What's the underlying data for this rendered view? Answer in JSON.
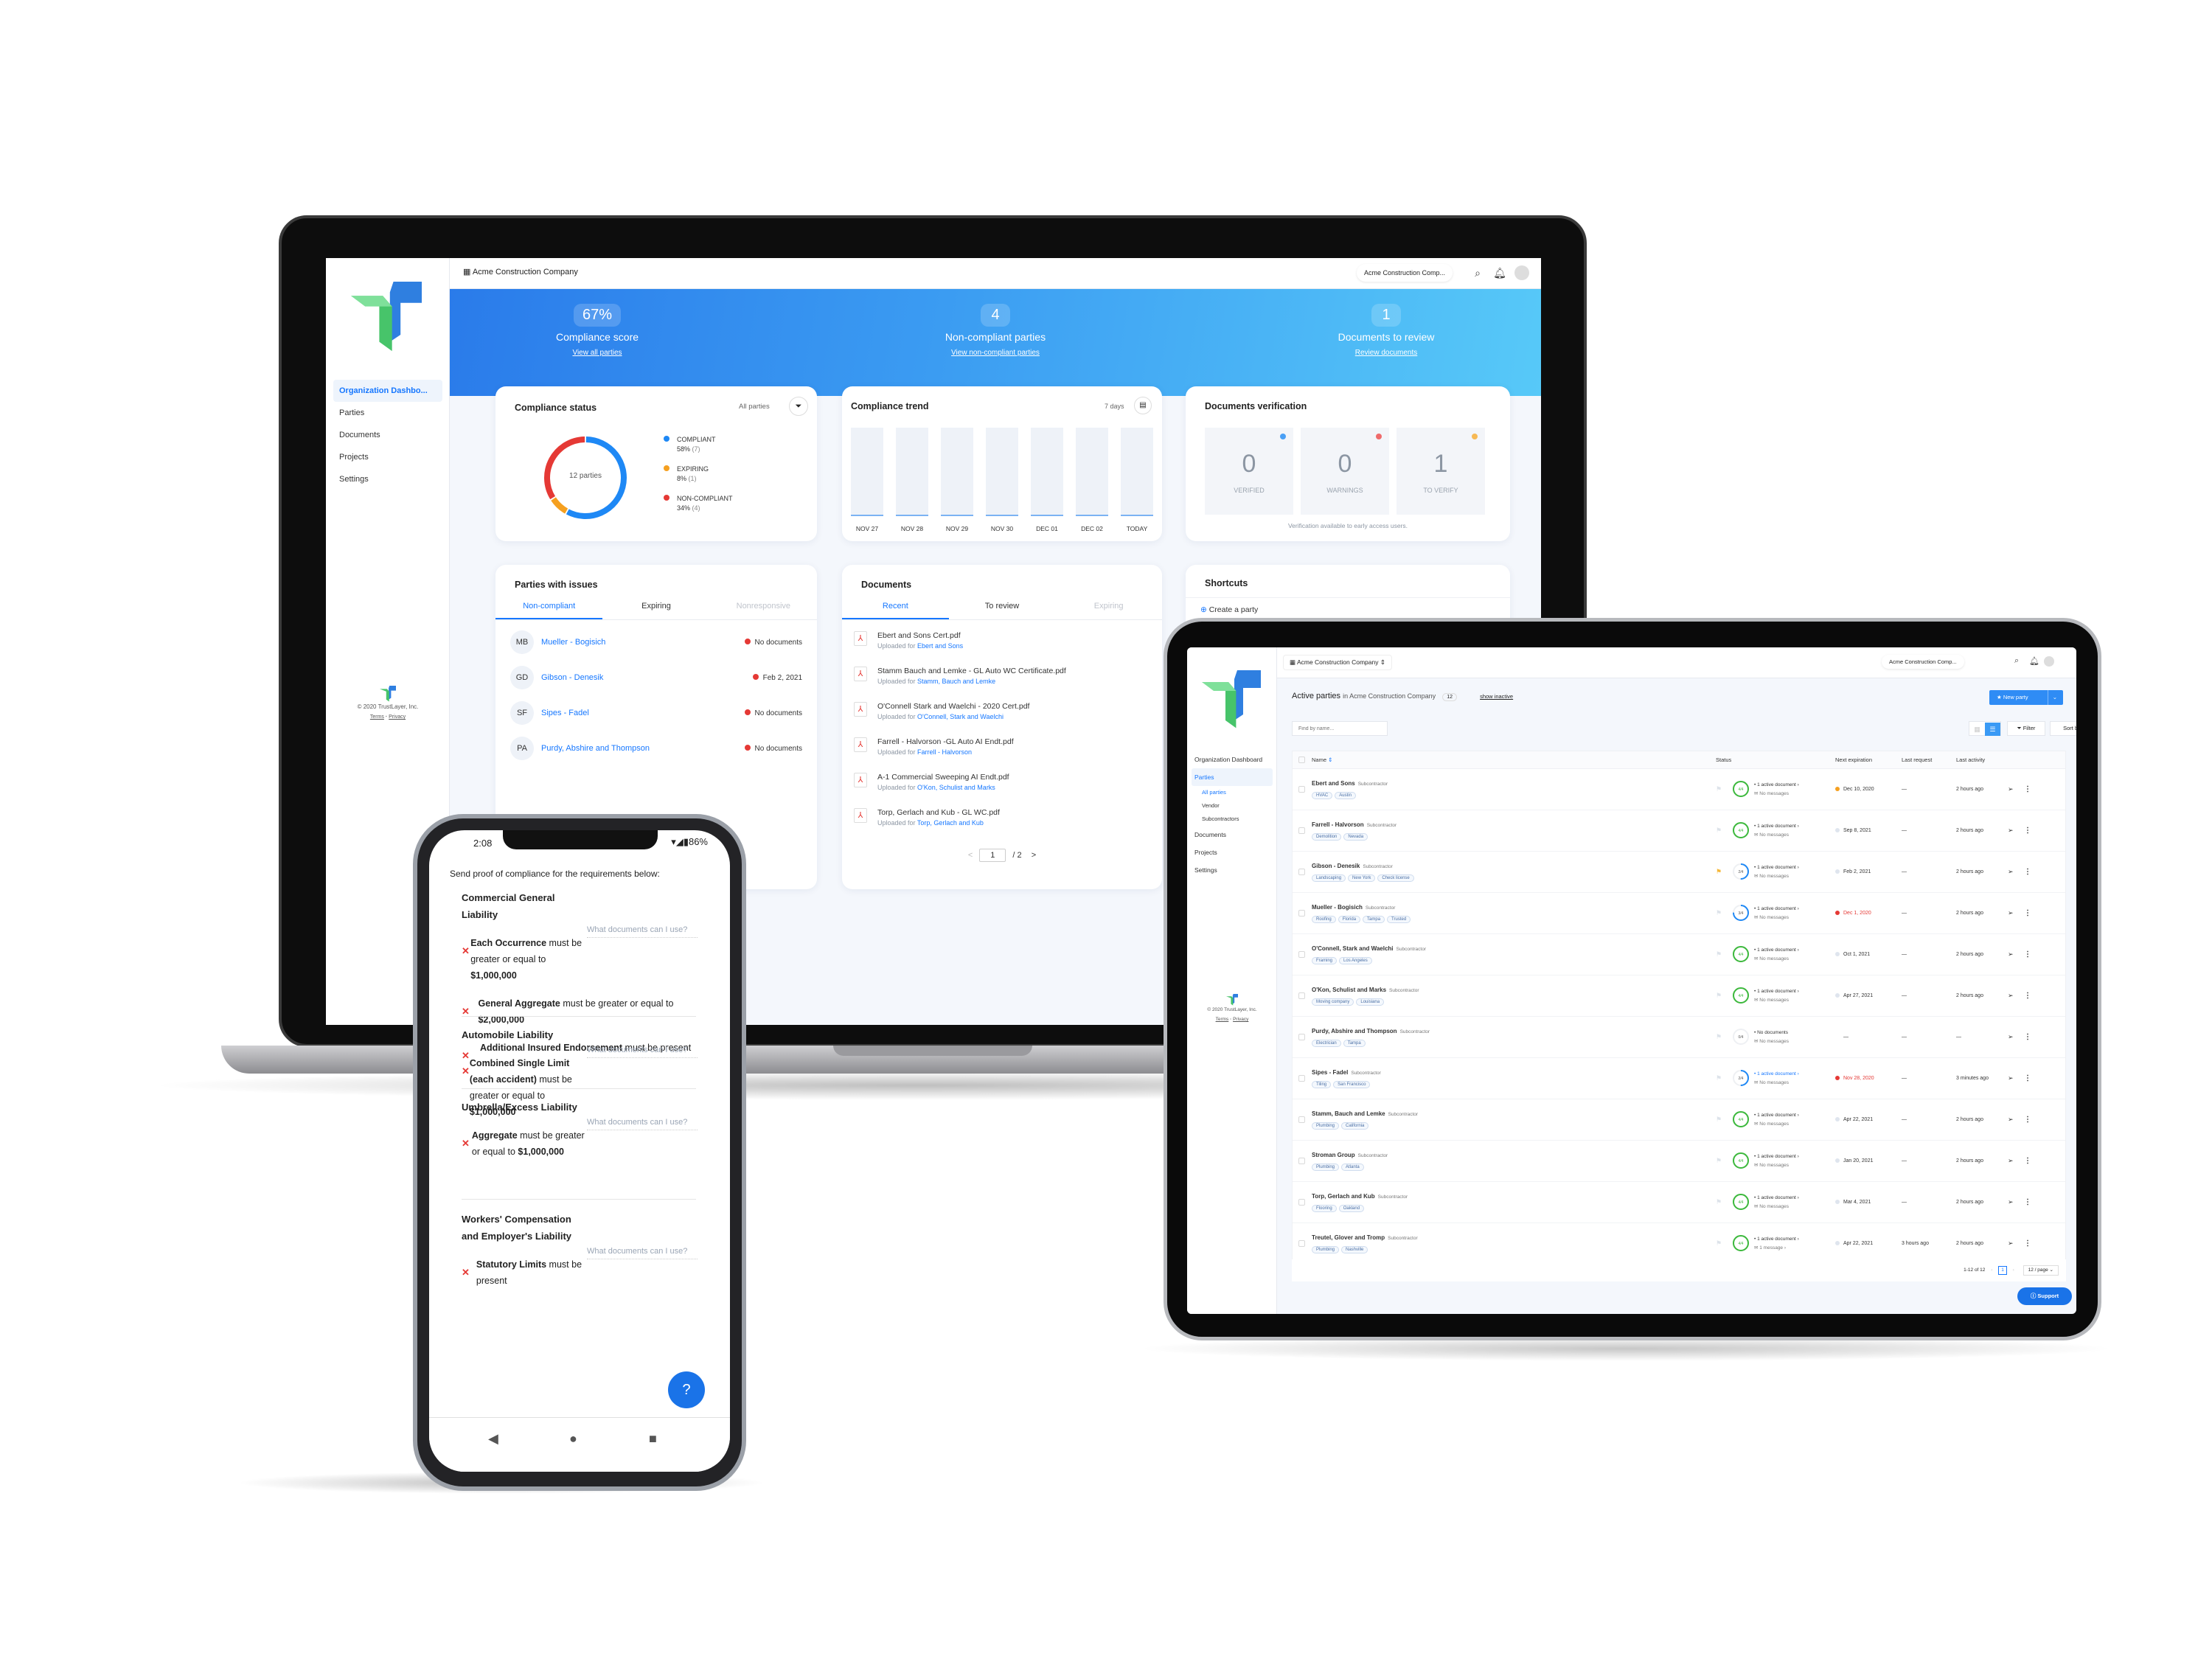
{
  "laptop": {
    "sidebar": {
      "items": [
        {
          "label": "Organization Dashbo...",
          "active": true
        },
        {
          "label": "Parties"
        },
        {
          "label": "Documents"
        },
        {
          "label": "Projects"
        },
        {
          "label": "Settings"
        }
      ],
      "footer": {
        "copyright": "© 2020 TrustLayer, Inc.",
        "terms": "Terms",
        "sep": " · ",
        "privacy": "Privacy"
      }
    },
    "topbar": {
      "org": "Acme Construction Company",
      "org_selector": "Acme Construction Comp...",
      "icons": [
        "building-icon",
        "search-icon",
        "bell-icon",
        "avatar"
      ]
    },
    "hero": [
      {
        "value": "67%",
        "label": "Compliance score",
        "link": "View all parties"
      },
      {
        "value": "4",
        "label": "Non-compliant parties",
        "link": "View non-compliant parties"
      },
      {
        "value": "1",
        "label": "Documents to review",
        "link": "Review documents"
      }
    ],
    "compliance_status": {
      "title": "Compliance status",
      "filter_label": "All parties",
      "center": "12 parties",
      "legend": [
        {
          "label": "COMPLIANT",
          "pct": "58%",
          "count": "(7)",
          "color": "#1e88f5"
        },
        {
          "label": "EXPIRING",
          "pct": "8%",
          "count": "(1)",
          "color": "#f5a020"
        },
        {
          "label": "NON-COMPLIANT",
          "pct": "34%",
          "count": "(4)",
          "color": "#e53935"
        }
      ]
    },
    "compliance_trend": {
      "title": "Compliance trend",
      "range": "7 days",
      "days": [
        "NOV 27",
        "NOV 28",
        "NOV 29",
        "NOV 30",
        "DEC 01",
        "DEC 02",
        "TODAY"
      ],
      "values": [
        0.02,
        0.02,
        0.02,
        0.02,
        0.02,
        0.02,
        0.02
      ]
    },
    "documents_verification": {
      "title": "Documents verification",
      "boxes": [
        {
          "value": "0",
          "label": "VERIFIED",
          "color": "#4a9ff5"
        },
        {
          "value": "0",
          "label": "WARNINGS",
          "color": "#ef6b6b"
        },
        {
          "value": "1",
          "label": "TO VERIFY",
          "color": "#f7b955"
        }
      ],
      "note": "Verification available to early access users."
    },
    "parties_with_issues": {
      "title": "Parties with issues",
      "tabs": [
        "Non-compliant",
        "Expiring",
        "Nonresponsive"
      ],
      "rows": [
        {
          "initials": "MB",
          "name": "Mueller - Bogisich",
          "status": "No documents"
        },
        {
          "initials": "GD",
          "name": "Gibson - Denesik",
          "status": "Feb 2, 2021"
        },
        {
          "initials": "SF",
          "name": "Sipes - Fadel",
          "status": "No documents"
        },
        {
          "initials": "PA",
          "name": "Purdy, Abshire and Thompson",
          "status": "No documents"
        }
      ]
    },
    "documents": {
      "title": "Documents",
      "tabs": [
        "Recent",
        "To review",
        "Expiring"
      ],
      "uploaded_prefix": "Uploaded for ",
      "rows": [
        {
          "file": "Ebert and Sons Cert.pdf",
          "party": "Ebert and Sons"
        },
        {
          "file": "Stamm Bauch and Lemke - GL Auto WC Certificate.pdf",
          "party": "Stamm, Bauch and Lemke"
        },
        {
          "file": "O'Connell Stark and Waelchi - 2020 Cert.pdf",
          "party": "O'Connell, Stark and Waelchi"
        },
        {
          "file": "Farrell - Halvorson -GL Auto AI Endt.pdf",
          "party": "Farrell - Halvorson"
        },
        {
          "file": "A-1 Commercial Sweeping AI Endt.pdf",
          "party": "O'Kon, Schulist and Marks"
        },
        {
          "file": "Torp, Gerlach and Kub - GL WC.pdf",
          "party": "Torp, Gerlach and Kub"
        }
      ],
      "pager": {
        "prev": "<",
        "page": "1",
        "total": "/ 2",
        "next": ">"
      }
    },
    "shortcuts": {
      "title": "Shortcuts",
      "items": [
        {
          "label": "Create a party"
        }
      ]
    }
  },
  "phone": {
    "time": "2:08",
    "battery": "86%",
    "intro": "Send proof of compliance for the requirements below:",
    "help_link": "What documents can I use?",
    "sections": [
      {
        "title": "Commercial General Liability",
        "requirements": [
          {
            "bold": "Each Occurrence",
            "text": " must be greater or equal to ",
            "value": "$1,000,000"
          },
          {
            "bold": "General Aggregate",
            "text": " must be greater or equal to ",
            "value": "$2,000,000"
          },
          {
            "bold": "Additional Insured Endorsement",
            "text": " must be present",
            "value": ""
          }
        ]
      },
      {
        "title": "Automobile Liability",
        "requirements": [
          {
            "bold": "Combined Single Limit (each accident)",
            "text": " must be greater or equal to ",
            "value": "$1,000,000"
          }
        ]
      },
      {
        "title": "Umbrella/Excess Liability",
        "requirements": [
          {
            "bold": "Aggregate",
            "text": " must be greater or equal to ",
            "value": "$1,000,000"
          }
        ]
      },
      {
        "title": "Workers' Compensation and Employer's Liability",
        "requirements": [
          {
            "bold": "Statutory Limits",
            "text": " must be present",
            "value": ""
          }
        ]
      }
    ]
  },
  "tablet": {
    "org": "Acme Construction Company",
    "org_selector": "Acme Construction Comp...",
    "sidebar": {
      "items": [
        "Organization Dashboard",
        "Parties",
        "All parties",
        "Vendor",
        "Subcontractors",
        "Documents",
        "Projects",
        "Settings"
      ],
      "footer": {
        "copyright": "© 2020 TrustLayer, Inc.",
        "terms": "Terms",
        "sep": " · ",
        "privacy": "Privacy"
      }
    },
    "header": {
      "title": "Active parties",
      "context": "in Acme Construction Company",
      "count": "12",
      "show_inactive": "show inactive"
    },
    "new_party": "New party",
    "search_placeholder": "Find by name...",
    "filter": "Filter",
    "sort": "Sort by: Name ↑",
    "columns": [
      "Name",
      "Status",
      "Next expiration",
      "Last request",
      "Last activity"
    ],
    "rows": [
      {
        "name": "Ebert and Sons",
        "role": "Subcontractor",
        "tags": [
          "HVAC",
          "Austin"
        ],
        "flag": false,
        "score": "4/4",
        "progress": 1.0,
        "docs": "1 active document ›",
        "msgs": "No messages",
        "exp": "Dec 10, 2020",
        "exp_state": "warning",
        "req": "—",
        "act": "2 hours ago"
      },
      {
        "name": "Farrell - Halvorson",
        "role": "Subcontractor",
        "tags": [
          "Demolition",
          "Nevada"
        ],
        "flag": false,
        "score": "4/4",
        "progress": 1.0,
        "docs": "1 active document ›",
        "msgs": "No messages",
        "exp": "Sep 8, 2021",
        "exp_state": "ok",
        "req": "—",
        "act": "2 hours ago"
      },
      {
        "name": "Gibson - Denesik",
        "role": "Subcontractor",
        "tags": [
          "Landscaping",
          "New York",
          "Check license"
        ],
        "flag": true,
        "score": "2/4",
        "progress": 0.5,
        "docs": "1 active document ›",
        "msgs": "No messages",
        "exp": "Feb 2, 2021",
        "exp_state": "ok",
        "req": "—",
        "act": "2 hours ago"
      },
      {
        "name": "Mueller - Bogisich",
        "role": "Subcontractor",
        "tags": [
          "Roofing",
          "Florida",
          "Tampa",
          "Trusted"
        ],
        "flag": false,
        "score": "3/4",
        "progress": 0.75,
        "docs": "1 active document ›",
        "msgs": "No messages",
        "exp": "Dec 1, 2020",
        "exp_state": "expired",
        "req": "—",
        "act": "2 hours ago"
      },
      {
        "name": "O'Connell, Stark and Waelchi",
        "role": "Subcontractor",
        "tags": [
          "Framing",
          "Los Angeles"
        ],
        "flag": false,
        "score": "4/4",
        "progress": 1.0,
        "docs": "1 active document ›",
        "msgs": "No messages",
        "exp": "Oct 1, 2021",
        "exp_state": "ok",
        "req": "—",
        "act": "2 hours ago"
      },
      {
        "name": "O'Kon, Schulist and Marks",
        "role": "Subcontractor",
        "tags": [
          "Moving company",
          "Louisiana"
        ],
        "flag": false,
        "score": "4/4",
        "progress": 1.0,
        "docs": "1 active document ›",
        "msgs": "No messages",
        "exp": "Apr 27, 2021",
        "exp_state": "ok",
        "req": "—",
        "act": "2 hours ago"
      },
      {
        "name": "Purdy, Abshire and Thompson",
        "role": "Subcontractor",
        "tags": [
          "Electrician",
          "Tampa"
        ],
        "flag": false,
        "score": "0/4",
        "progress": 0.0,
        "docs": "No documents",
        "msgs": "No messages",
        "exp": "—",
        "exp_state": "none",
        "req": "—",
        "act": "—"
      },
      {
        "name": "Sipes - Fadel",
        "role": "Subcontractor",
        "tags": [
          "Tiling",
          "San Francisco"
        ],
        "flag": false,
        "score": "2/4",
        "progress": 0.5,
        "docs": "1 active document ›",
        "docs_highlight": true,
        "msgs": "No messages",
        "exp": "Nov 28, 2020",
        "exp_state": "expired",
        "req": "—",
        "act": "3 minutes ago"
      },
      {
        "name": "Stamm, Bauch and Lemke",
        "role": "Subcontractor",
        "tags": [
          "Plumbing",
          "California"
        ],
        "flag": false,
        "score": "4/4",
        "progress": 1.0,
        "docs": "1 active document ›",
        "msgs": "No messages",
        "exp": "Apr 22, 2021",
        "exp_state": "ok",
        "req": "—",
        "act": "2 hours ago"
      },
      {
        "name": "Stroman Group",
        "role": "Subcontractor",
        "tags": [
          "Plumbing",
          "Atlanta"
        ],
        "flag": false,
        "score": "4/4",
        "progress": 1.0,
        "docs": "1 active document ›",
        "msgs": "No messages",
        "exp": "Jan 20, 2021",
        "exp_state": "ok",
        "req": "—",
        "act": "2 hours ago"
      },
      {
        "name": "Torp, Gerlach and Kub",
        "role": "Subcontractor",
        "tags": [
          "Flooring",
          "Oakland"
        ],
        "flag": false,
        "score": "4/4",
        "progress": 1.0,
        "docs": "1 active document ›",
        "msgs": "No messages",
        "exp": "Mar 4, 2021",
        "exp_state": "ok",
        "req": "—",
        "act": "2 hours ago"
      },
      {
        "name": "Treutel, Glover and Tromp",
        "role": "Subcontractor",
        "tags": [
          "Plumbing",
          "Nashville"
        ],
        "flag": false,
        "score": "4/4",
        "progress": 1.0,
        "docs": "1 active document ›",
        "msgs": "1 message ›",
        "exp": "Apr 22, 2021",
        "exp_state": "ok",
        "req": "3 hours ago",
        "act": "2 hours ago"
      }
    ],
    "pager": {
      "range": "1-12 of 12",
      "page": "1",
      "per_page": "12 / page"
    },
    "support": "Support"
  },
  "colors": {
    "accent": "#1677ff",
    "compliant": "#1e88f5",
    "expiring": "#f5a020",
    "noncompliant": "#e53935",
    "ok_ring": "#3cb93c"
  }
}
